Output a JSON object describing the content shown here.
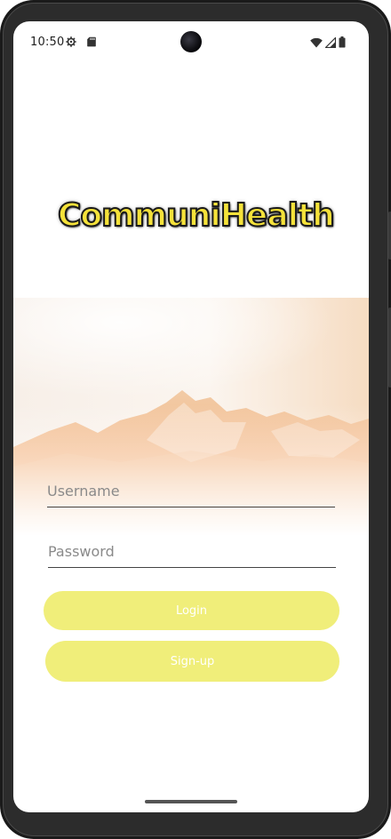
{
  "status_bar": {
    "time": "10:50",
    "left_icons": [
      "settings-icon",
      "sd-card-icon"
    ],
    "right_icons": [
      "wifi-icon",
      "signal-icon",
      "battery-icon"
    ]
  },
  "app": {
    "logo_text": "CommuniHealth"
  },
  "login_form": {
    "username_placeholder": "Username",
    "password_placeholder": "Password",
    "login_label": "Login",
    "signup_label": "Sign-up"
  },
  "colors": {
    "button": "#f0ee7a",
    "button_text": "#ffffff",
    "logo_fill": "#f5e23a",
    "logo_outline": "#1a1a1a",
    "hero_tint": "#f3b57a"
  }
}
